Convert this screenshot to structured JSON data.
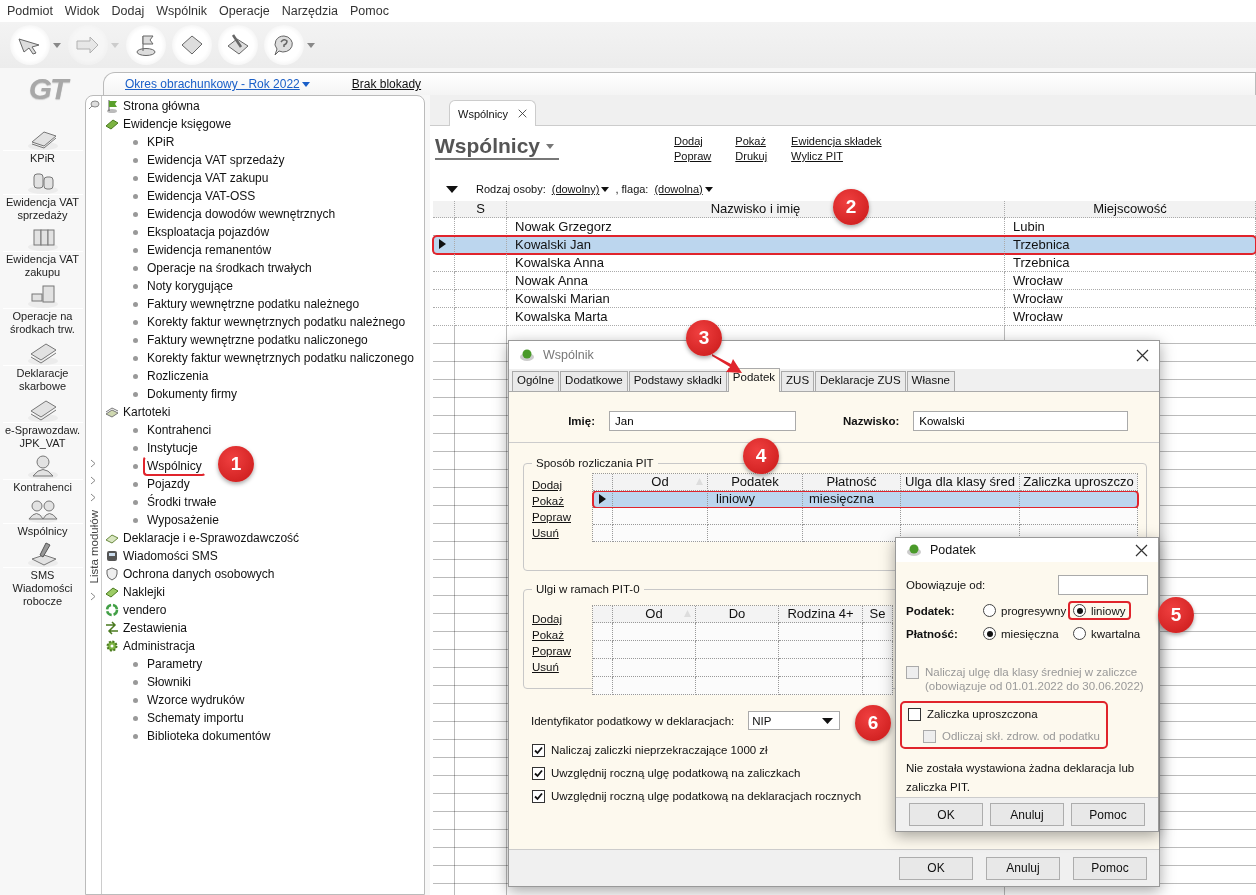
{
  "menu": [
    "Podmiot",
    "Widok",
    "Dodaj",
    "Wspólnik",
    "Operacje",
    "Narzędzia",
    "Pomoc"
  ],
  "toolbar": [
    {
      "kind": "pointer",
      "dropdown": true,
      "disabled": false
    },
    {
      "kind": "arrow",
      "dropdown": true,
      "disabled": true
    },
    {
      "kind": "flag",
      "dropdown": false,
      "disabled": false
    },
    {
      "kind": "page",
      "dropdown": false,
      "disabled": false
    },
    {
      "kind": "brush",
      "dropdown": false,
      "disabled": false
    },
    {
      "kind": "help",
      "dropdown": true,
      "disabled": false
    }
  ],
  "logo": "GT",
  "modules": [
    {
      "label": "KPiR",
      "kind": "book"
    },
    {
      "label": "Ewidencja VAT sprzedaży",
      "kind": "coins"
    },
    {
      "label": "Ewidencja VAT zakupu",
      "kind": "binders"
    },
    {
      "label": "Operacje na środkach trw.",
      "kind": "cabinet"
    },
    {
      "label": "Deklaracje skarbowe",
      "kind": "papers"
    },
    {
      "label": "e-Sprawozdaw. JPK_VAT",
      "kind": "papers"
    },
    {
      "label": "Kontrahenci",
      "kind": "person"
    },
    {
      "label": "Wspólnicy",
      "kind": "people"
    },
    {
      "label": "SMS Wiadomości robocze",
      "kind": "pen"
    }
  ],
  "period_link": "Okres obrachunkowy - Rok 2022",
  "lock_link": "Brak blokady",
  "module_list_label": "Lista modułów",
  "tree": [
    {
      "label": "Strona główna",
      "kind": "flag"
    },
    {
      "label": "Ewidencje księgowe",
      "kind": "book",
      "children": [
        {
          "label": "KPiR"
        },
        {
          "label": "Ewidencja VAT sprzedaży"
        },
        {
          "label": "Ewidencja VAT zakupu"
        },
        {
          "label": "Ewidencja VAT-OSS"
        },
        {
          "label": "Ewidencja dowodów wewnętrznych"
        },
        {
          "label": "Eksploatacja pojazdów"
        },
        {
          "label": "Ewidencja remanentów"
        },
        {
          "label": "Operacje na środkach trwałych"
        },
        {
          "label": "Noty korygujące"
        },
        {
          "label": "Faktury wewnętrzne podatku należnego"
        },
        {
          "label": "Korekty faktur wewnętrznych podatku należnego"
        },
        {
          "label": "Faktury wewnętrzne podatku naliczonego"
        },
        {
          "label": "Korekty faktur wewnętrznych podatku naliczonego"
        },
        {
          "label": "Rozliczenia"
        },
        {
          "label": "Dokumenty firmy"
        }
      ]
    },
    {
      "label": "Kartoteki",
      "kind": "cards",
      "children": [
        {
          "label": "Kontrahenci",
          "highlighted": false
        },
        {
          "label": "Instytucje",
          "highlighted": false
        },
        {
          "label": "Wspólnicy",
          "highlighted": true
        },
        {
          "label": "Pojazdy",
          "highlighted": false
        },
        {
          "label": "Środki trwałe",
          "highlighted": false
        },
        {
          "label": "Wyposażenie",
          "highlighted": false
        }
      ]
    },
    {
      "label": "Deklaracje i e-Sprawozdawczość",
      "kind": "papers"
    },
    {
      "label": "Wiadomości SMS",
      "kind": "sms"
    },
    {
      "label": "Ochrona danych osobowych",
      "kind": "shield"
    },
    {
      "label": "Naklejki",
      "kind": "sticker"
    },
    {
      "label": "vendero",
      "kind": "recycle"
    },
    {
      "label": "Zestawienia",
      "kind": "chart"
    },
    {
      "label": "Administracja",
      "kind": "gear",
      "children": [
        {
          "label": "Parametry"
        },
        {
          "label": "Słowniki"
        },
        {
          "label": "Wzorce wydruków"
        },
        {
          "label": "Schematy importu"
        },
        {
          "label": "Biblioteka dokumentów"
        }
      ]
    }
  ],
  "tab": {
    "label": "Wspólnicy"
  },
  "heading": "Wspólnicy",
  "actions": [
    [
      "Dodaj",
      "Popraw"
    ],
    [
      "Pokaż",
      "Drukuj"
    ],
    [
      "Ewidencja składek",
      "Wylicz PIT"
    ]
  ],
  "filters": [
    {
      "label": "Rodzaj osoby:",
      "value": "(dowolny)"
    },
    {
      "label": ", flaga:",
      "value": "(dowolna)"
    }
  ],
  "table": {
    "columns": [
      "S",
      "Nazwisko i imię",
      "Miejscowość"
    ],
    "rows": [
      {
        "name": "Nowak Grzegorz",
        "city": "Lubin",
        "selected": false,
        "highlighted": false
      },
      {
        "name": "Kowalski Jan",
        "city": "Trzebnica",
        "selected": true,
        "highlighted": true
      },
      {
        "name": "Kowalska Anna",
        "city": "Trzebnica",
        "selected": false,
        "highlighted": false
      },
      {
        "name": "Nowak Anna",
        "city": "Wrocław",
        "selected": false,
        "highlighted": false
      },
      {
        "name": "Kowalski Marian",
        "city": "Wrocław",
        "selected": false,
        "highlighted": false
      },
      {
        "name": "Kowalska Marta",
        "city": "Wrocław",
        "selected": false,
        "highlighted": false
      }
    ]
  },
  "partner_dialog": {
    "title": "Wspólnik",
    "tabs": [
      {
        "label": "Ogólne",
        "selected": false
      },
      {
        "label": "Dodatkowe",
        "selected": false
      },
      {
        "label": "Podstawy składki",
        "selected": false
      },
      {
        "label": "Podatek",
        "selected": true
      },
      {
        "label": "ZUS",
        "selected": false
      },
      {
        "label": "Deklaracje ZUS",
        "selected": false
      },
      {
        "label": "Własne",
        "selected": false
      }
    ],
    "first_name": {
      "label": "Imię:",
      "value": "Jan"
    },
    "last_name": {
      "label": "Nazwisko:",
      "value": "Kowalski"
    },
    "pit": {
      "title": "Sposób rozliczania PIT",
      "links": [
        "Dodaj",
        "Pokaż",
        "Popraw",
        "Usuń"
      ],
      "columns": [
        "Od",
        "Podatek",
        "Płatność",
        "Ulga dla klasy śred",
        "Zaliczka uproszczo"
      ],
      "rows": [
        {
          "tax": "liniowy",
          "payment": "miesięczna",
          "selected": true,
          "highlighted": true
        }
      ]
    },
    "reliefs": {
      "title": "Ulgi w ramach PIT-0",
      "links": [
        "Dodaj",
        "Pokaż",
        "Popraw",
        "Usuń"
      ],
      "columns": [
        "Od",
        "Do",
        "Rodzina 4+",
        "Se"
      ]
    },
    "tax_id": {
      "label": "Identyfikator podatkowy w deklaracjach:",
      "value": "NIP"
    },
    "options": [
      {
        "label": "Naliczaj zaliczki nieprzekraczające 1000 zł",
        "checked": true
      },
      {
        "label": "Uwzględnij roczną ulgę podatkową na zaliczkach",
        "checked": true
      },
      {
        "label": "Uwzględnij roczną ulgę podatkową na deklaracjach rocznych",
        "checked": true
      }
    ],
    "buttons": [
      "OK",
      "Anuluj",
      "Pomoc"
    ]
  },
  "tax_dialog": {
    "title": "Podatek",
    "valid_from": {
      "label": "Obowiązuje od:"
    },
    "radio_groups": [
      {
        "label": "Podatek:",
        "options": [
          {
            "label": "progresywny",
            "selected": false,
            "highlighted": false
          },
          {
            "label": "liniowy",
            "selected": true,
            "highlighted": true
          }
        ]
      },
      {
        "label": "Płatność:",
        "options": [
          {
            "label": "miesięczna",
            "selected": true,
            "highlighted": false
          },
          {
            "label": "kwartalna",
            "selected": false,
            "highlighted": false
          }
        ]
      }
    ],
    "middle_class": {
      "label": "Naliczaj ulgę dla klasy średniej w zaliczce (obowiązuje od 01.01.2022 do 30.06.2022)",
      "checked": false,
      "disabled": true
    },
    "simplified": {
      "highlighted": true,
      "main": {
        "label": "Zaliczka uproszczona",
        "checked": false,
        "disabled": false
      },
      "sub": {
        "label": "Odliczaj skł. zdrow. od podatku",
        "checked": false,
        "disabled": true
      }
    },
    "note": "Nie została wystawiona żadna deklaracja lub zaliczka PIT.",
    "buttons": [
      "OK",
      "Anuluj",
      "Pomoc"
    ]
  },
  "badges": [
    "1",
    "2",
    "3",
    "4",
    "5",
    "6"
  ]
}
